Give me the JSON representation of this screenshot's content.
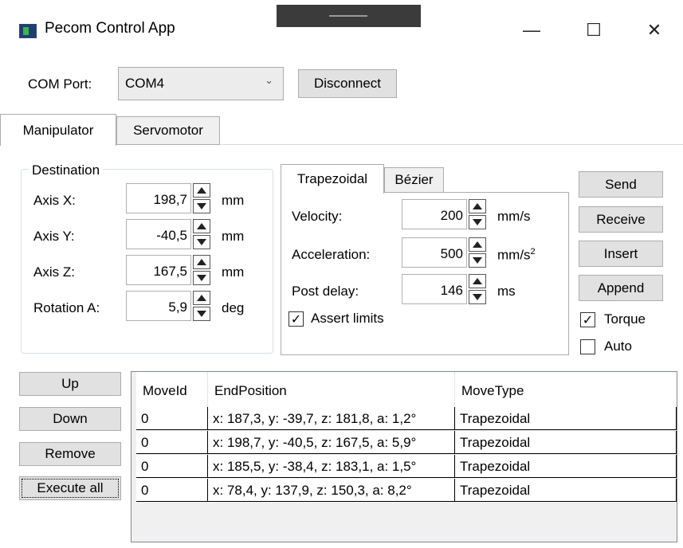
{
  "window": {
    "title": "Pecom Control App",
    "minimize": "—",
    "maximize": "☐",
    "close": "✕"
  },
  "connection": {
    "com_label": "COM Port:",
    "com_value": "COM4",
    "disconnect_label": "Disconnect"
  },
  "main_tabs": [
    {
      "label": "Manipulator"
    },
    {
      "label": "Servomotor"
    }
  ],
  "destination": {
    "title": "Destination",
    "axes": [
      {
        "label": "Axis X:",
        "value": "198,7",
        "unit": "mm"
      },
      {
        "label": "Axis Y:",
        "value": "-40,5",
        "unit": "mm"
      },
      {
        "label": "Axis Z:",
        "value": "167,5",
        "unit": "mm"
      },
      {
        "label": "Rotation A:",
        "value": "5,9",
        "unit": "deg"
      }
    ]
  },
  "motion_tabs": [
    {
      "label": "Trapezoidal"
    },
    {
      "label": "Bézier"
    }
  ],
  "motion": {
    "params": [
      {
        "label": "Velocity:",
        "value": "200",
        "unit": "mm/s"
      },
      {
        "label": "Acceleration:",
        "value": "500",
        "unit": "mm/s",
        "unit_sup": "2"
      },
      {
        "label": "Post delay:",
        "value": "146",
        "unit": "ms"
      }
    ],
    "assert_limits": {
      "label": "Assert limits",
      "checked": true
    }
  },
  "actions": {
    "send": "Send",
    "receive": "Receive",
    "insert": "Insert",
    "append": "Append"
  },
  "toggles": {
    "torque": {
      "label": "Torque",
      "checked": true
    },
    "auto": {
      "label": "Auto",
      "checked": false
    }
  },
  "list_buttons": {
    "up": "Up",
    "down": "Down",
    "remove": "Remove",
    "execute_all": "Execute all"
  },
  "grid": {
    "columns": [
      "MoveId",
      "EndPosition",
      "MoveType"
    ],
    "rows": [
      {
        "id": "0",
        "pos": "x: 187,3, y: -39,7, z: 181,8, a: 1,2°",
        "type": "Trapezoidal"
      },
      {
        "id": "0",
        "pos": "x: 198,7, y: -40,5, z: 167,5, a: 5,9°",
        "type": "Trapezoidal"
      },
      {
        "id": "0",
        "pos": "x: 185,5, y: -38,4, z: 183,1, a: 1,5°",
        "type": "Trapezoidal"
      },
      {
        "id": "0",
        "pos": "x: 78,4, y: 137,9, z: 150,3, a: 8,2°",
        "type": "Trapezoidal"
      }
    ]
  }
}
